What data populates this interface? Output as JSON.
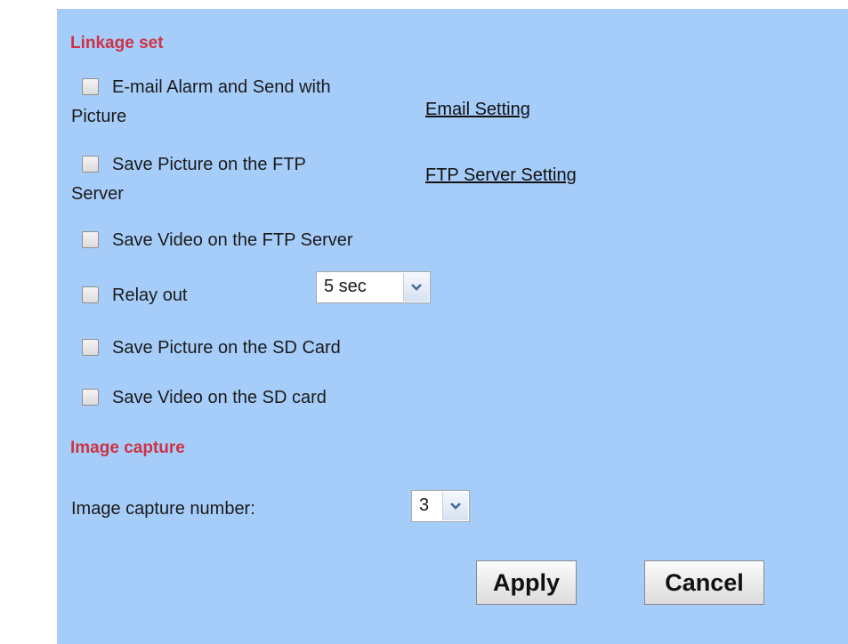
{
  "linkage": {
    "title": "Linkage set",
    "email_alarm": {
      "line1": "E-mail Alarm and Send with",
      "line2": "Picture",
      "checked": false
    },
    "email_setting_link": "Email Setting",
    "ftp_picture": {
      "line1": "Save Picture on the FTP",
      "line2": "Server",
      "checked": false
    },
    "ftp_setting_link": "FTP Server Setting",
    "ftp_video": {
      "label": "Save Video on the FTP Server",
      "checked": false
    },
    "relay_out": {
      "label": "Relay out",
      "checked": false,
      "duration": "5 sec"
    },
    "sd_picture": {
      "label": "Save Picture on the SD Card",
      "checked": false
    },
    "sd_video": {
      "label": "Save Video on the SD card",
      "checked": false
    }
  },
  "image_capture": {
    "title": "Image capture",
    "number_label": "Image capture number:",
    "number_value": "3"
  },
  "buttons": {
    "apply": "Apply",
    "cancel": "Cancel"
  },
  "colors": {
    "panel_background": "#a6cdf9",
    "section_title": "#cc3344"
  },
  "icons": {
    "dropdown": "chevron-down-icon"
  }
}
